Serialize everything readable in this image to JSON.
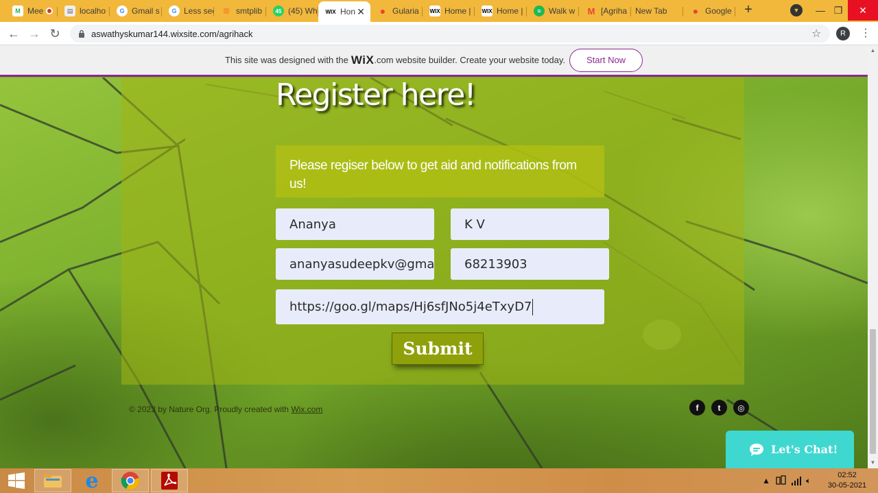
{
  "browser": {
    "tabs": [
      {
        "title": "Mee",
        "icon": "meet-icon",
        "color": "#34a853"
      },
      {
        "title": "localho",
        "icon": "page-icon",
        "color": "#666666"
      },
      {
        "title": "Gmail s",
        "icon": "google-icon",
        "color": "#4285f4"
      },
      {
        "title": "Less sec",
        "icon": "google-icon",
        "color": "#4285f4"
      },
      {
        "title": "smtplib",
        "icon": "stackoverflow-icon",
        "color": "#f48024"
      },
      {
        "title": "(45) Wh",
        "icon": "whatsapp-icon",
        "color": "#25d366"
      },
      {
        "title": "Hon",
        "icon": "wix-icon",
        "color": "#000000",
        "active": true
      },
      {
        "title": "Gularia",
        "icon": "maps-icon",
        "color": "#ea4335"
      },
      {
        "title": "Home |",
        "icon": "wix-icon",
        "color": "#000000"
      },
      {
        "title": "Home |",
        "icon": "wix-icon",
        "color": "#000000"
      },
      {
        "title": "Walk w",
        "icon": "spotify-icon",
        "color": "#1db954"
      },
      {
        "title": "[Agriha",
        "icon": "gmail-icon",
        "color": "#ea4335"
      },
      {
        "title": "New Tab",
        "icon": "",
        "color": ""
      },
      {
        "title": "Google",
        "icon": "maps-icon",
        "color": "#ea4335"
      }
    ],
    "url": "aswathyskumar144.wixsite.com/agrihack",
    "profile_initial": "R"
  },
  "wix_banner": {
    "text_before": "This site was designed with the",
    "logo_text": "WiX",
    "text_after": ".com website builder. Create your website today.",
    "cta": "Start Now"
  },
  "page": {
    "heading": "Register here!",
    "note": "Please regiser below to get aid and notifications from us!",
    "form": {
      "first_name": "Ananya",
      "last_name": "K V",
      "email": "ananyasudeepkv@gmail...",
      "phone": "68213903",
      "location": "https://goo.gl/maps/Hj6sfJNo5j4eTxyD7"
    },
    "submit_label": "Submit",
    "footer": {
      "text": "© 2023 by Nature Org. Proudly created with",
      "link": "Wix.com"
    },
    "social": [
      {
        "name": "facebook",
        "glyph": "f"
      },
      {
        "name": "twitter",
        "glyph": "t"
      },
      {
        "name": "instagram",
        "glyph": "◎"
      }
    ],
    "chat_label": "Let's Chat!"
  },
  "taskbar": {
    "time": "02:52",
    "date": "30-05-2021"
  },
  "colors": {
    "accent_purple": "#8a2a8f",
    "chrome_tabstrip": "#f2b83b",
    "chat_teal": "#3fd8d0",
    "submit_olive": "#8fa10a"
  }
}
